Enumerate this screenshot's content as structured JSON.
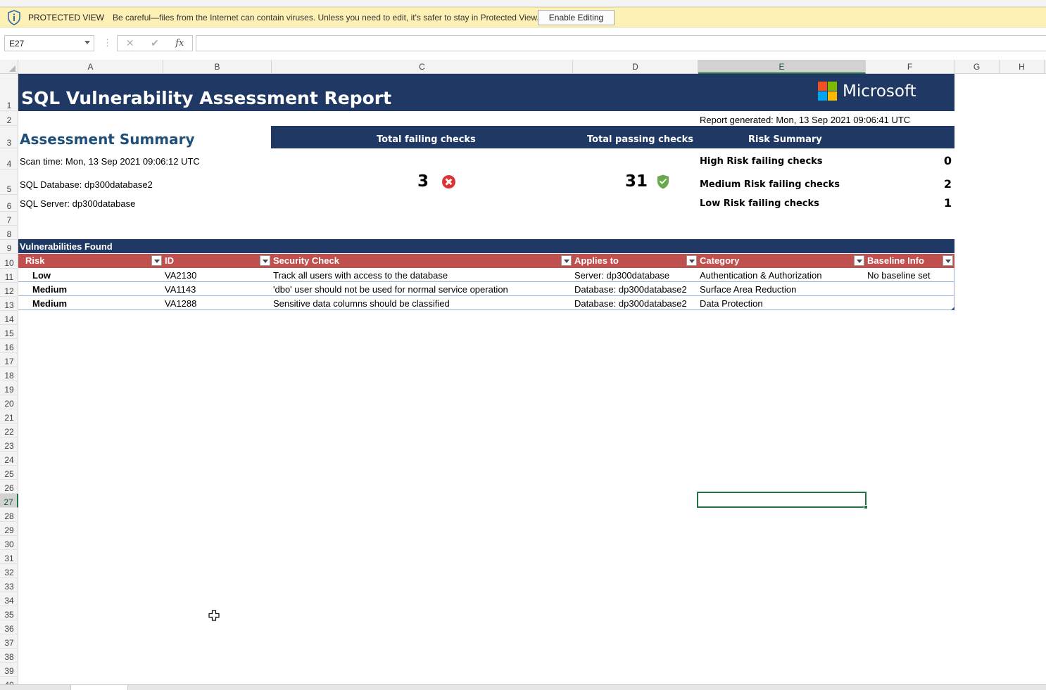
{
  "protected_view": {
    "title": "PROTECTED VIEW",
    "message": "Be careful—files from the Internet can contain viruses. Unless you need to edit, it's safer to stay in Protected View.",
    "button_label": "Enable Editing"
  },
  "formula_bar": {
    "name_box": "E27",
    "cancel_glyph": "✕",
    "enter_glyph": "✔",
    "fx_glyph": "fx",
    "formula": ""
  },
  "columns": [
    "A",
    "B",
    "C",
    "D",
    "E",
    "F",
    "G",
    "H"
  ],
  "selected_column": "E",
  "selected_row": "27",
  "report": {
    "title": "SQL Vulnerability Assessment Report",
    "brand": "Microsoft",
    "generated": "Report generated: Mon, 13 Sep 2021 09:06:41 UTC",
    "summary_title": "Assessment Summary",
    "headers": {
      "failing": "Total failing checks",
      "passing": "Total passing checks",
      "risk": "Risk Summary"
    },
    "scan_time": "Scan time: Mon, 13 Sep 2021 09:06:12 UTC",
    "database": "SQL Database: dp300database2",
    "server": "SQL Server: dp300database",
    "failing_count": "3",
    "passing_count": "31",
    "risk_summary": [
      {
        "label": "High Risk failing checks",
        "value": "0"
      },
      {
        "label": "Medium Risk failing checks",
        "value": "2"
      },
      {
        "label": "Low Risk failing checks",
        "value": "1"
      }
    ]
  },
  "vulnerabilities": {
    "title": "Vulnerabilities Found",
    "columns": [
      "Risk",
      "ID",
      "Security Check",
      "Applies to",
      "Category",
      "Baseline Info"
    ],
    "rows": [
      [
        "Low",
        "VA2130",
        "Track all users with access to the database",
        "Server: dp300database",
        "Authentication & Authorization",
        "No baseline set"
      ],
      [
        "Medium",
        "VA1143",
        "'dbo' user should not be used for normal service operation",
        "Database: dp300database2",
        "Surface Area Reduction",
        ""
      ],
      [
        "Medium",
        "VA1288",
        "Sensitive data columns should be classified",
        "Database: dp300database2",
        "Data Protection",
        ""
      ]
    ]
  },
  "colors": {
    "banner": "#1f3864",
    "table_header": "#c0504d",
    "selection": "#217346",
    "protected_bar": "#fdf1b5"
  },
  "icons": {
    "protected_view": "shield-info-icon",
    "failing": "error-circle-icon",
    "passing": "shield-check-icon",
    "filter": "filter-dropdown-icon",
    "cursor": "cell-select-cursor-icon"
  }
}
